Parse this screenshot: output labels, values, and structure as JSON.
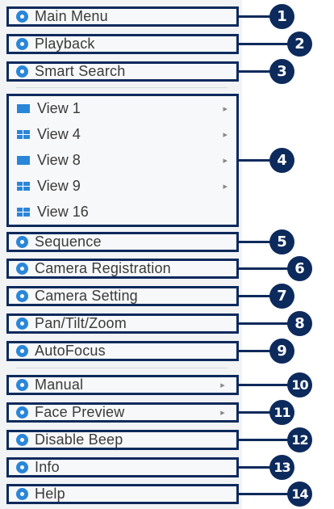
{
  "menu": {
    "main_menu": "Main Menu",
    "playback": "Playback",
    "smart_search": "Smart Search",
    "views": [
      {
        "label": "View 1",
        "has_submenu": true
      },
      {
        "label": "View 4",
        "has_submenu": true
      },
      {
        "label": "View 8",
        "has_submenu": true
      },
      {
        "label": "View 9",
        "has_submenu": true
      },
      {
        "label": "View 16",
        "has_submenu": false
      }
    ],
    "sequence": "Sequence",
    "camera_registration": "Camera Registration",
    "camera_setting": "Camera Setting",
    "pan_tilt_zoom": "Pan/Tilt/Zoom",
    "autofocus": "AutoFocus",
    "manual": "Manual",
    "face_preview": "Face Preview",
    "disable_beep": "Disable Beep",
    "info": "Info",
    "help": "Help",
    "submenu_glyph": "▸"
  },
  "callouts": [
    "1",
    "2",
    "3",
    "4",
    "5",
    "6",
    "7",
    "8",
    "9",
    "10",
    "11",
    "12",
    "13",
    "14"
  ],
  "colors": {
    "outline": "#0d2a5c",
    "icon_accent": "#2a86d8",
    "menu_background": "#f1f3f5",
    "text": "#3a3a3a"
  },
  "icons": {
    "main_menu": "home-icon",
    "playback": "play-icon",
    "smart_search": "search-icon",
    "views": "layout-grid-icon",
    "sequence": "sequence-icon",
    "camera_registration": "camera-registration-icon",
    "camera_setting": "camera-setting-icon",
    "pan_tilt_zoom": "ptz-icon",
    "autofocus": "focus-icon",
    "manual": "manual-icon",
    "face_preview": "face-icon",
    "disable_beep": "mute-icon",
    "info": "info-icon",
    "help": "help-icon"
  }
}
